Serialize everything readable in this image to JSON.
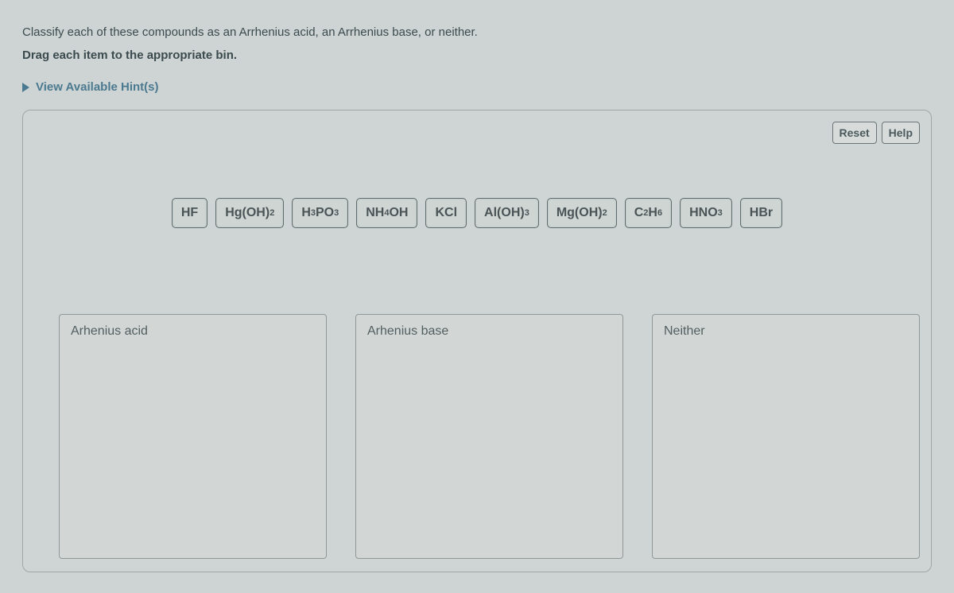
{
  "instructions": {
    "line1": "Classify each of these compounds as an Arrhenius acid, an Arrhenius base, or neither.",
    "line2": "Drag each item to the appropriate bin."
  },
  "hints": {
    "label": "View Available Hint(s)"
  },
  "actions": {
    "reset": "Reset",
    "help": "Help"
  },
  "tiles": {
    "hf": "HF",
    "hgoh2_a": "Hg(OH)",
    "hgoh2_b": "2",
    "h3po3_a": "H",
    "h3po3_b": "3",
    "h3po3_c": "PO",
    "h3po3_d": "3",
    "nh4oh_a": "NH",
    "nh4oh_b": "4",
    "nh4oh_c": "OH",
    "kcl": "KCl",
    "aloh3_a": "Al(OH)",
    "aloh3_b": "3",
    "mgoh2_a": "Mg(OH)",
    "mgoh2_b": "2",
    "c2h6_a": "C",
    "c2h6_b": "2",
    "c2h6_c": "H",
    "c2h6_d": "6",
    "hno3_a": "HNO",
    "hno3_b": "3",
    "hbr": "HBr"
  },
  "bins": {
    "acid": "Arhenius acid",
    "base": "Arhenius base",
    "neither": "Neither"
  }
}
